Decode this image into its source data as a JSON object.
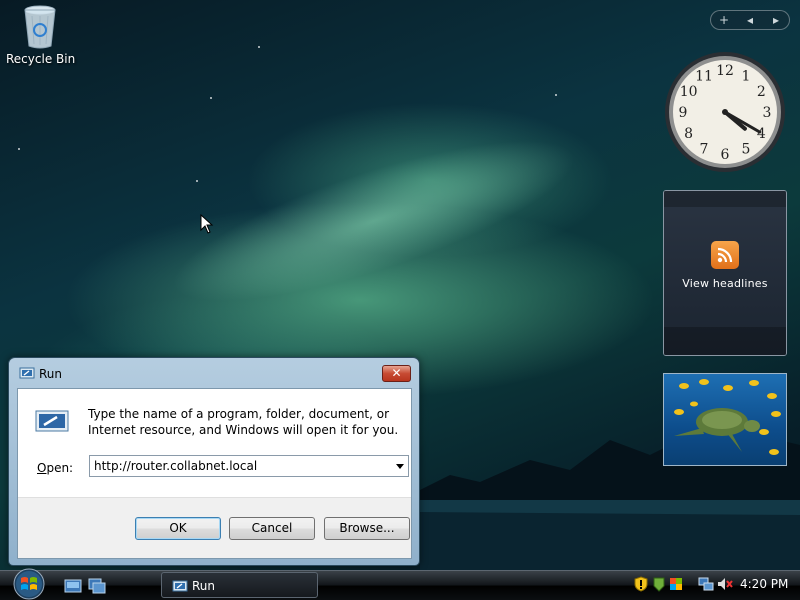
{
  "desktop": {
    "recycle_bin_label": "Recycle Bin"
  },
  "sidebar": {
    "add_symbol": "+",
    "prev_symbol": "◂",
    "next_symbol": "▸",
    "clock": {
      "time_hours": 4,
      "time_minutes": 20,
      "numerals": [
        "12",
        "1",
        "2",
        "3",
        "4",
        "5",
        "6",
        "7",
        "8",
        "9",
        "10",
        "11"
      ]
    },
    "feed": {
      "label": "View headlines"
    }
  },
  "run_dialog": {
    "title": "Run",
    "close_symbol": "✕",
    "description": "Type the name of a program, folder, document, or Internet resource, and Windows will open it for you.",
    "open_label": "Open:",
    "open_value": "http://router.collabnet.local",
    "buttons": {
      "ok": "OK",
      "cancel": "Cancel",
      "browse": "Browse..."
    }
  },
  "taskbar": {
    "task_item": "Run",
    "clock": "4:20 PM"
  },
  "colors": {
    "accent": "#3c7fb1",
    "close": "#c74b33",
    "rss": "#e1701a"
  }
}
